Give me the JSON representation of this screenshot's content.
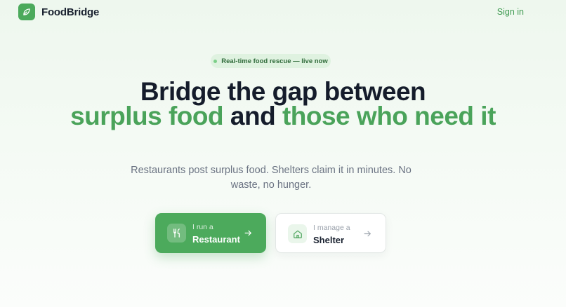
{
  "brand": {
    "name": "FoodBridge",
    "logo_icon": "leaf-icon",
    "accent_color": "#4caa5c"
  },
  "nav": {
    "sign_in": "Sign in"
  },
  "hero": {
    "badge": "Real-time food rescue — live now",
    "headline": {
      "line1": "Bridge the gap between",
      "part_green_1": "surplus food",
      "part_dark": "and",
      "part_green_2": "those who need it"
    },
    "subtitle": "Restaurants post surplus food. Shelters claim it in minutes. No waste, no hunger."
  },
  "cta": {
    "restaurant": {
      "small": "I run a",
      "big": "Restaurant",
      "icon": "utensils-icon"
    },
    "shelter": {
      "small": "I manage a",
      "big": "Shelter",
      "icon": "home-icon"
    }
  }
}
